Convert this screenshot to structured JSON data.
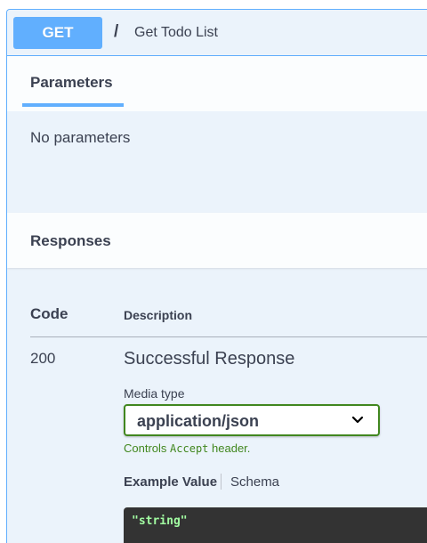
{
  "operation": {
    "method": "GET",
    "path": "/",
    "summary": "Get Todo List"
  },
  "parameters": {
    "tab_label": "Parameters",
    "empty_text": "No parameters"
  },
  "responses": {
    "title": "Responses",
    "columns": {
      "code": "Code",
      "description": "Description"
    },
    "rows": [
      {
        "code": "200",
        "description": "Successful Response",
        "media_type_label": "Media type",
        "media_type_value": "application/json",
        "controls_prefix": "Controls",
        "controls_code": "Accept",
        "controls_suffix": "header.",
        "example_tab": "Example Value",
        "schema_tab": "Schema",
        "example_body": "\"string\""
      }
    ]
  },
  "colors": {
    "get_accent": "#61affe",
    "get_bg": "#ebf3fb",
    "select_border": "#41871f",
    "code_bg": "#333333",
    "code_text": "#a2fca2"
  },
  "icons": {
    "select_chevron": "chevron-down-icon"
  }
}
